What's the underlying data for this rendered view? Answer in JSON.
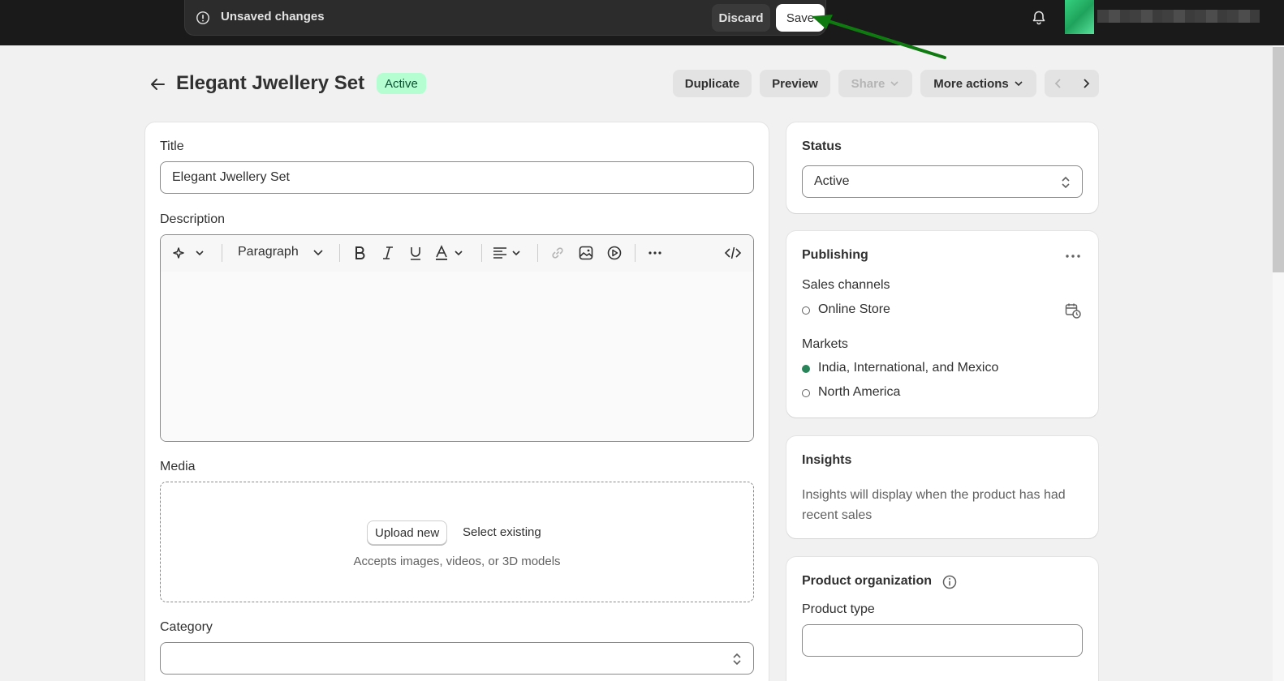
{
  "save_bar": {
    "message": "Unsaved changes",
    "discard_label": "Discard",
    "save_label": "Save"
  },
  "header": {
    "title": "Elegant Jwellery Set",
    "status_badge": "Active",
    "actions": {
      "duplicate": "Duplicate",
      "preview": "Preview",
      "share": "Share",
      "more_actions": "More actions"
    }
  },
  "main": {
    "title_label": "Title",
    "title_value": "Elegant Jwellery Set",
    "description_label": "Description",
    "editor": {
      "paragraph_label": "Paragraph"
    },
    "media_label": "Media",
    "media": {
      "upload_new": "Upload new",
      "select_existing": "Select existing",
      "hint": "Accepts images, videos, or 3D models"
    },
    "category_label": "Category",
    "category_value": ""
  },
  "sidebar": {
    "status": {
      "title": "Status",
      "value": "Active"
    },
    "publishing": {
      "title": "Publishing",
      "sales_channels_label": "Sales channels",
      "channels": [
        {
          "name": "Online Store",
          "active": false
        }
      ],
      "markets_label": "Markets",
      "markets": [
        {
          "name": "India, International, and Mexico",
          "active": true
        },
        {
          "name": "North America",
          "active": false
        }
      ]
    },
    "insights": {
      "title": "Insights",
      "text": "Insights will display when the product has had recent sales"
    },
    "organization": {
      "title": "Product organization",
      "product_type_label": "Product type",
      "product_type_value": ""
    }
  },
  "colors": {
    "topbar": "#1a1a1a",
    "badge_bg": "#b4fed2",
    "badge_text": "#0c5132",
    "market_active": "#29845a",
    "annotation_arrow": "#0f7a0f"
  }
}
